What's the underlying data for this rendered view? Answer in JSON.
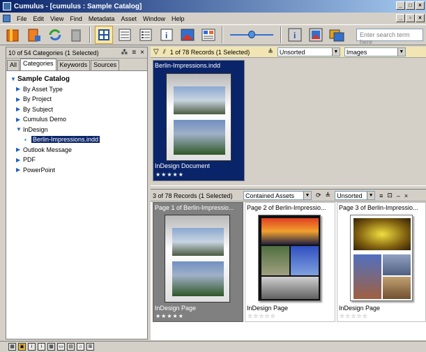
{
  "window": {
    "title": "Cumulus - [cumulus : Sample Catalog]"
  },
  "menu": [
    "File",
    "Edit",
    "View",
    "Find",
    "Metadata",
    "Asset",
    "Window",
    "Help"
  ],
  "toolbar": {
    "search_placeholder": "Enter search term here"
  },
  "left_panel": {
    "header": "10 of 54 Categories (1 Selected)",
    "tabs": [
      "All",
      "Categories",
      "Keywords",
      "Sources"
    ],
    "tree": [
      {
        "label": "Sample Catalog"
      },
      {
        "label": "By Asset Type"
      },
      {
        "label": "By Project"
      },
      {
        "label": "By Subject"
      },
      {
        "label": "Cumulus Demo"
      },
      {
        "label": "InDesign"
      },
      {
        "label": "Berlin-Impressions.indd"
      },
      {
        "label": "Outlook Message"
      },
      {
        "label": "PDF"
      },
      {
        "label": "PowerPoint"
      }
    ]
  },
  "upper": {
    "records": "1 of 78 Records (1 Selected)",
    "sort": "Unsorted",
    "view": "Images",
    "card": {
      "title": "Berlin-Impressions.indd",
      "type": "InDesign Document",
      "stars": "★★★★★"
    }
  },
  "lower": {
    "records": "3 of 78 Records (1 Selected)",
    "filter": "Contained Assets",
    "sort": "Unsorted",
    "cards": [
      {
        "title": "Page 1 of Berlin-Impressio...",
        "type": "InDesign Page",
        "stars": "★★★★★"
      },
      {
        "title": "Page 2 of Berlin-Impressio...",
        "type": "InDesign Page",
        "stars": "☆☆☆☆☆"
      },
      {
        "title": "Page 3 of Berlin-Impressio...",
        "type": "InDesign Page",
        "stars": "☆☆☆☆☆"
      }
    ]
  },
  "colors": {
    "selection": "#0a246a",
    "highlight_header": "#f1e5b3"
  }
}
